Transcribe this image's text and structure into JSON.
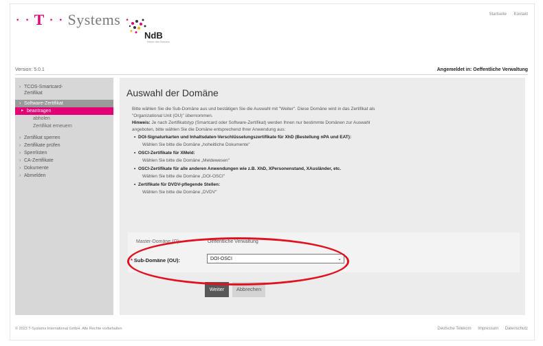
{
  "header": {
    "logo_text": "Systems",
    "logo_t": "T",
    "ndb_text": "NdB",
    "ndb_sub": "Netze des Bundes",
    "links": [
      "Startseite",
      "Kontakt"
    ]
  },
  "status": {
    "version": "Version: 5.0.1",
    "logged_in": "Angemeldet in: Oeffentliche Verwaltung"
  },
  "sidebar": {
    "items": [
      {
        "label": "TCOS-Smartcard-Zertifikat"
      },
      {
        "label": "Software-Zertifikat"
      },
      {
        "label": "beantragen"
      },
      {
        "label": "abholen"
      },
      {
        "label": "Zertifikat erneuern"
      },
      {
        "label": "Zertifikat sperren"
      },
      {
        "label": "Zertifikate prüfen"
      },
      {
        "label": "Sperrlisten"
      },
      {
        "label": "CA-Zertifikate"
      },
      {
        "label": "Dokumente"
      },
      {
        "label": "Abmelden"
      }
    ]
  },
  "main": {
    "title": "Auswahl der Domäne",
    "intro_line1": "Bitte wählen Sie die Sub-Domäne aus und bestätigen Sie die Auswahl mit \"Weiter\". Diese Domäne wird in das Zertifikat als",
    "intro_line2": "\"Organizational Unit (OU)\" übernommen.",
    "hint_label": "Hinweis:",
    "hint_line1": " Je nach Zertifikatstyp (Smartcard oder Software-Zertifikat) werden Ihnen nur bestimmte Domänen zur Auswahl",
    "hint_line2": "angeboten, bitte wählen Sie die Domäne entsprechend Ihrer Anwendung aus:",
    "bullets": [
      {
        "title": "DOI-Signaturkarten und Inhaltsdaten-Verschlüsselungszertifikate für XhD (Bestellung nPA und EAT):",
        "sub": "Wählen Sie bitte die Domäne „hoheitliche Dokumente\""
      },
      {
        "title": "OSCI-Zertifikate für XMeld:",
        "sub": "Wählen Sie bitte die Domäne „Meldewesen\""
      },
      {
        "title": "OSCI-Zertifikate für alle anderen Anwendungen wie z.B. XhD, XPersonenstand, XAusländer, etc.",
        "sub": "Wählen Sie bitte die Domäne „DOI-OSCI\""
      },
      {
        "title": "Zertifikate für DVDV-pflegende Stellen:",
        "sub": "Wählen Sie bitte die Domäne „DVDV\""
      }
    ],
    "master_label": "Master-Domäne (O):",
    "master_value": "Oeffentliche Verwaltung",
    "sub_label": "Sub-Domäne (OU):",
    "sub_required": "*",
    "sub_selected": "DOI-OSCI",
    "btn_next": "Weiter",
    "btn_cancel": "Abbrechen"
  },
  "footer": {
    "copyright": "© 2023 T-Systems International GmbH. Alle Rechte vorbehalten",
    "links": [
      "Deutsche Telekom",
      "Impressum",
      "Datenschutz"
    ]
  },
  "annotation_color": "#e0121f",
  "accent_color": "#e20074"
}
